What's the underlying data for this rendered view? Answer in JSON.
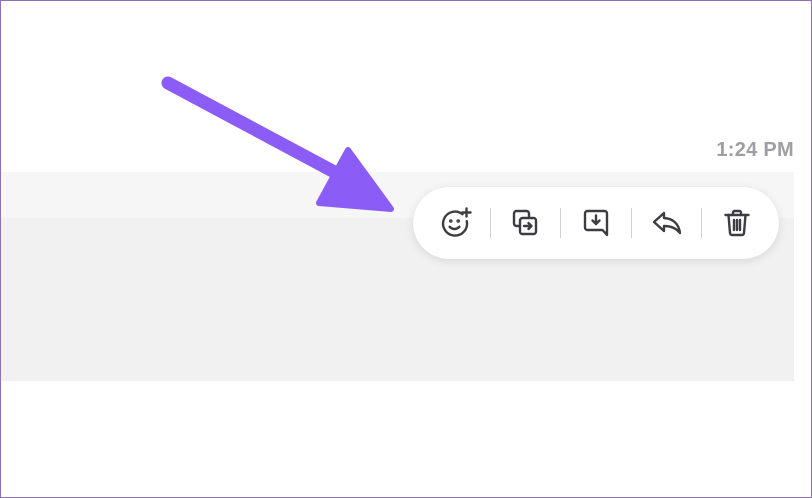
{
  "message": {
    "timestamp": "1:24 PM"
  },
  "toolbar": {
    "actions": [
      {
        "id": "react",
        "icon": "emoji-add-icon",
        "tooltip": ""
      },
      {
        "id": "forward",
        "icon": "forward-copy-icon",
        "tooltip": ""
      },
      {
        "id": "save",
        "icon": "save-message-icon",
        "tooltip": ""
      },
      {
        "id": "reply",
        "icon": "reply-icon",
        "tooltip": ""
      },
      {
        "id": "delete",
        "icon": "trash-icon",
        "tooltip": ""
      }
    ]
  },
  "colors": {
    "annotation_arrow": "#8b5cf6",
    "icon": "#3c3c43",
    "timestamp": "#9e9ea3",
    "message_bg": "#f1f1f2",
    "frame_border": "#8e6fb3"
  }
}
